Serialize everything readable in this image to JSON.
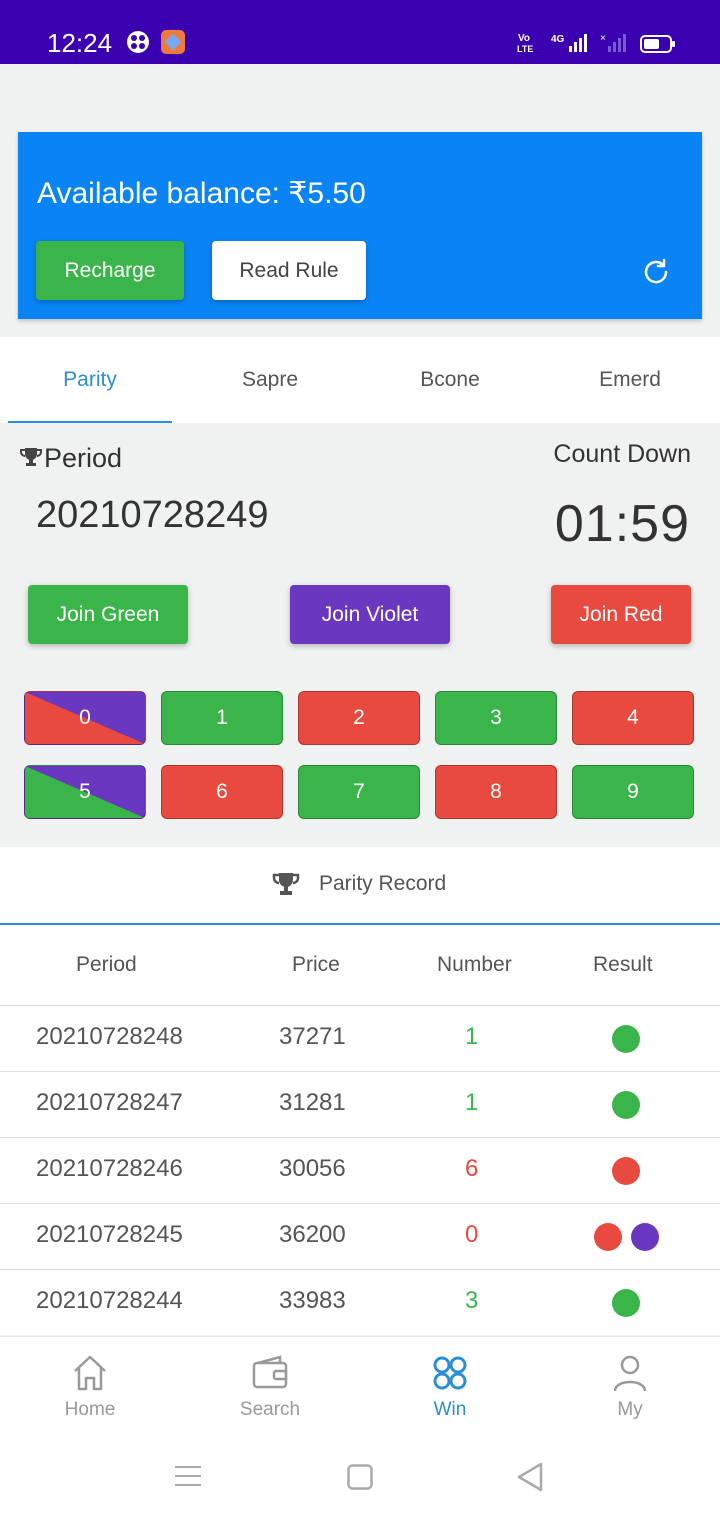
{
  "status_bar": {
    "time": "12:24",
    "network": "4G"
  },
  "balance": {
    "text": "Available balance: ₹5.50",
    "recharge_label": "Recharge",
    "read_rule_label": "Read Rule"
  },
  "tabs": [
    {
      "label": "Parity",
      "active": true
    },
    {
      "label": "Sapre",
      "active": false
    },
    {
      "label": "Bcone",
      "active": false
    },
    {
      "label": "Emerd",
      "active": false
    }
  ],
  "game": {
    "period_label": "Period",
    "period_value": "20210728249",
    "countdown_label": "Count Down",
    "countdown_value": "01:59",
    "join_green": "Join Green",
    "join_violet": "Join Violet",
    "join_red": "Join Red",
    "numbers": [
      "0",
      "1",
      "2",
      "3",
      "4",
      "5",
      "6",
      "7",
      "8",
      "9"
    ]
  },
  "record": {
    "title": "Parity Record",
    "columns": [
      "Period",
      "Price",
      "Number",
      "Result"
    ],
    "rows": [
      {
        "period": "20210728248",
        "price": "37271",
        "number": "1",
        "number_color": "#3ab54a",
        "result": [
          "green"
        ]
      },
      {
        "period": "20210728247",
        "price": "31281",
        "number": "1",
        "number_color": "#3ab54a",
        "result": [
          "green"
        ]
      },
      {
        "period": "20210728246",
        "price": "30056",
        "number": "6",
        "number_color": "#e84a40",
        "result": [
          "red"
        ]
      },
      {
        "period": "20210728245",
        "price": "36200",
        "number": "0",
        "number_color": "#e84a40",
        "result": [
          "red",
          "violet"
        ]
      },
      {
        "period": "20210728244",
        "price": "33983",
        "number": "3",
        "number_color": "#3ab54a",
        "result": [
          "green"
        ]
      }
    ]
  },
  "nav": [
    {
      "label": "Home",
      "icon": "home-icon"
    },
    {
      "label": "Search",
      "icon": "wallet-icon"
    },
    {
      "label": "Win",
      "icon": "win-icon",
      "active": true
    },
    {
      "label": "My",
      "icon": "user-icon"
    }
  ],
  "colors": {
    "green": "#3ab54a",
    "red": "#e84a40",
    "violet": "#6a38c0",
    "accent": "#2a8ed8",
    "status_bar": "#3b00b0",
    "balance_card": "#0a84f5"
  }
}
